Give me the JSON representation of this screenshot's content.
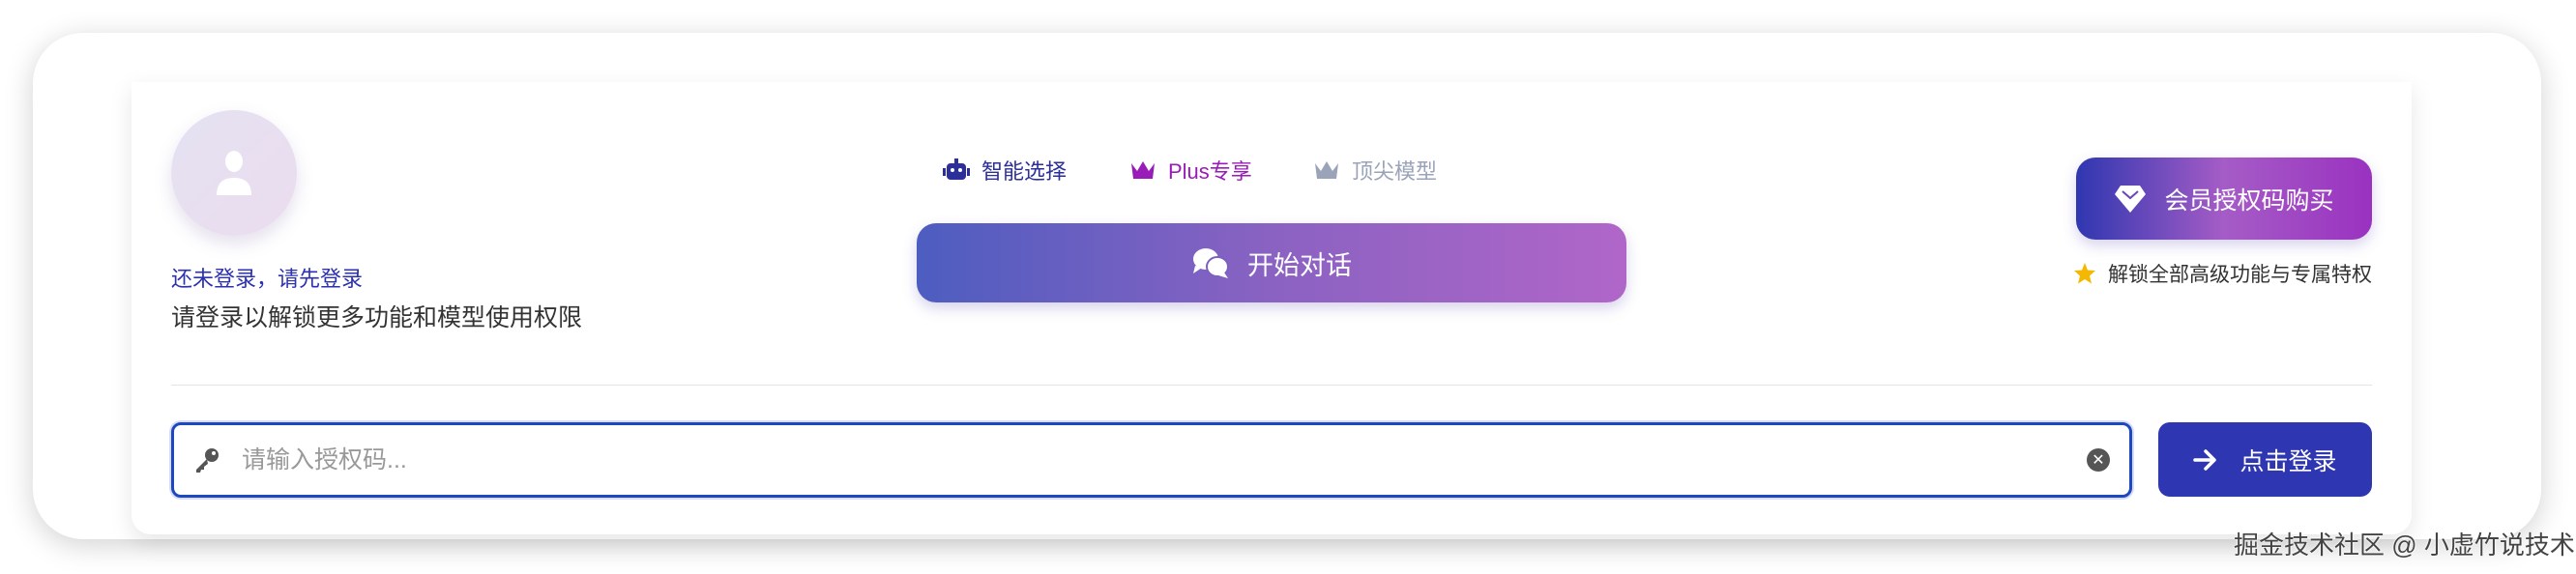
{
  "user": {
    "status": "还未登录，请先登录",
    "hint": "请登录以解锁更多功能和模型使用权限"
  },
  "tabs": [
    {
      "label": "智能选择",
      "icon": "robot-icon",
      "color": "#2c2f9a"
    },
    {
      "label": "Plus专享",
      "icon": "crown-icon",
      "color": "#9a1cb8"
    },
    {
      "label": "顶尖模型",
      "icon": "crown-icon",
      "color": "#9aa3b8"
    }
  ],
  "start_button": "开始对话",
  "buy_button": "会员授权码购买",
  "perk": "解锁全部高级功能与专属特权",
  "input": {
    "placeholder": "请输入授权码...",
    "value": ""
  },
  "login_button": "点击登录",
  "watermark": "掘金技术社区 @ 小虚竹说技术"
}
